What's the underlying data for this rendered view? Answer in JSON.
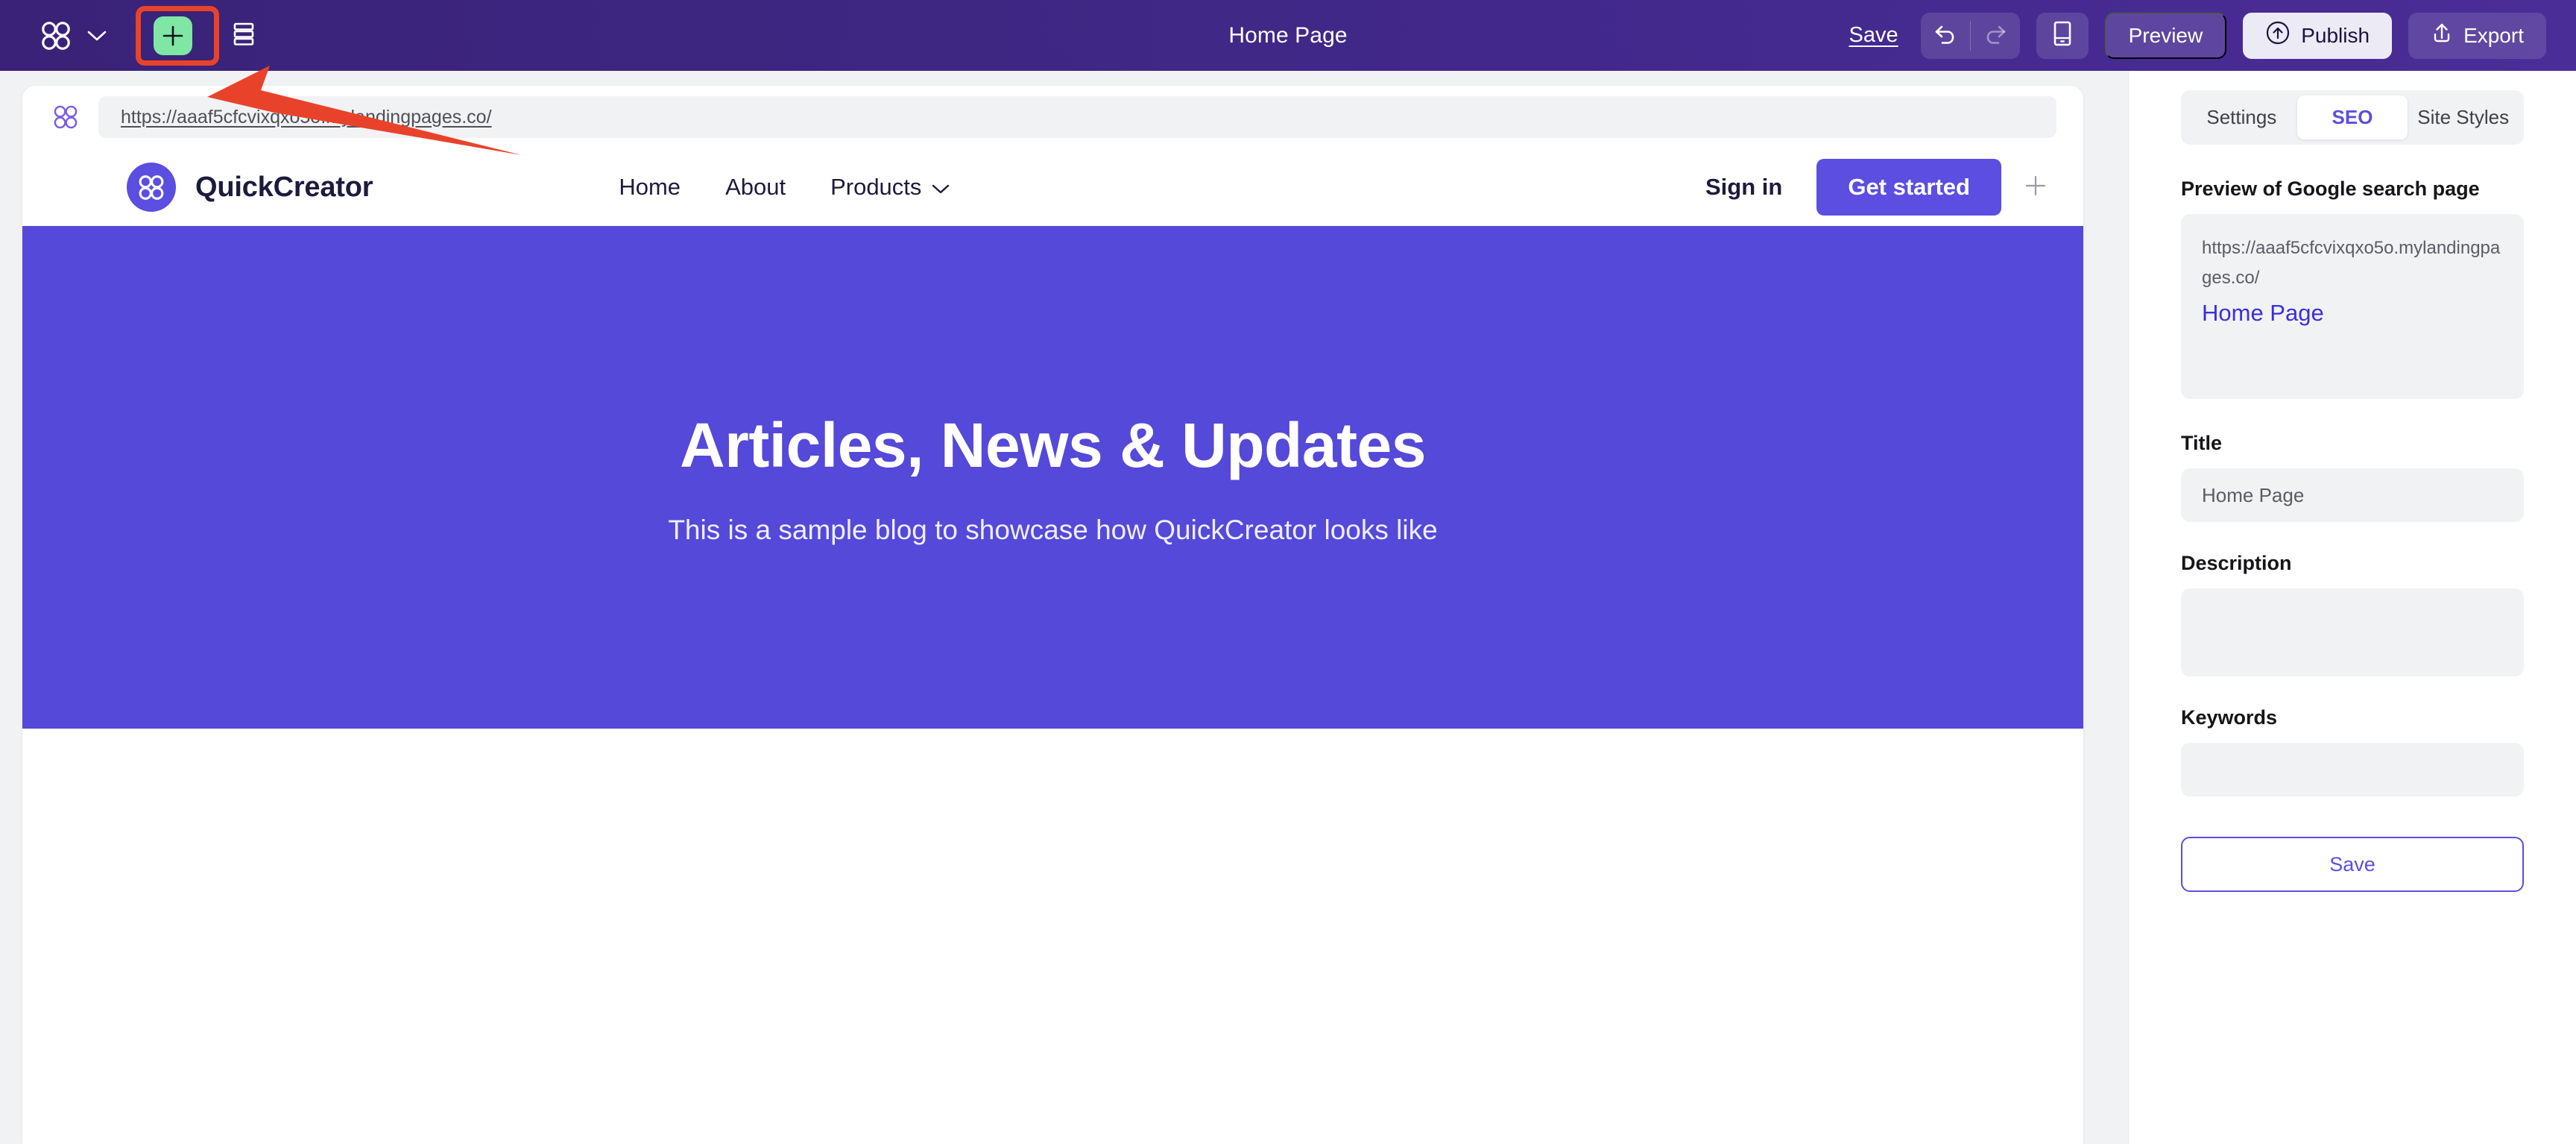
{
  "topbar": {
    "page_title": "Home Page",
    "logo_icon": "quickcreator-logo-icon",
    "workspace_chevron_icon": "chevron-down-icon",
    "add_section_icon": "plus-icon",
    "sections_icon": "stacked-rows-icon",
    "save_label": "Save",
    "undo_icon": "undo-arrow-icon",
    "redo_icon": "redo-arrow-icon",
    "device_icon": "mobile-device-icon",
    "preview_label": "Preview",
    "publish_label": "Publish",
    "publish_icon": "cloud-upload-icon",
    "export_label": "Export",
    "export_icon": "upload-icon",
    "background_color": "#3d2782"
  },
  "canvas": {
    "address_bar": {
      "favicon": "quickcreator-favicon-icon",
      "url": "https://aaaf5cfcvixqxo5o.mylandingpages.co/"
    },
    "site_header": {
      "brand_name": "QuickCreator",
      "brand_icon": "quickcreator-logo-icon",
      "nav": [
        {
          "label": "Home",
          "has_dropdown": false
        },
        {
          "label": "About",
          "has_dropdown": false
        },
        {
          "label": "Products",
          "has_dropdown": true
        }
      ],
      "signin_label": "Sign in",
      "cta_label": "Get started",
      "add_element_icon": "plus-icon"
    },
    "hero": {
      "heading": "Articles, News & Updates",
      "subheading": "This is a sample blog to showcase how QuickCreator looks like",
      "background_color": "#5449d9"
    }
  },
  "panel": {
    "tabs": [
      {
        "label": "Settings",
        "active": false
      },
      {
        "label": "SEO",
        "active": true
      },
      {
        "label": "Site Styles",
        "active": false
      }
    ],
    "preview_label": "Preview of Google search page",
    "preview_url": "https://aaaf5cfcvixqxo5o.mylandingpages.co/",
    "preview_title": "Home Page",
    "title_label": "Title",
    "title_value": "Home Page",
    "description_label": "Description",
    "description_value": "",
    "keywords_label": "Keywords",
    "keywords_value": "",
    "save_label": "Save",
    "accent_color": "#5b4ee0"
  },
  "annotations": {
    "highlight_target": "add-section-button",
    "arrow_target": "add-section-button",
    "color": "#e8432a"
  }
}
